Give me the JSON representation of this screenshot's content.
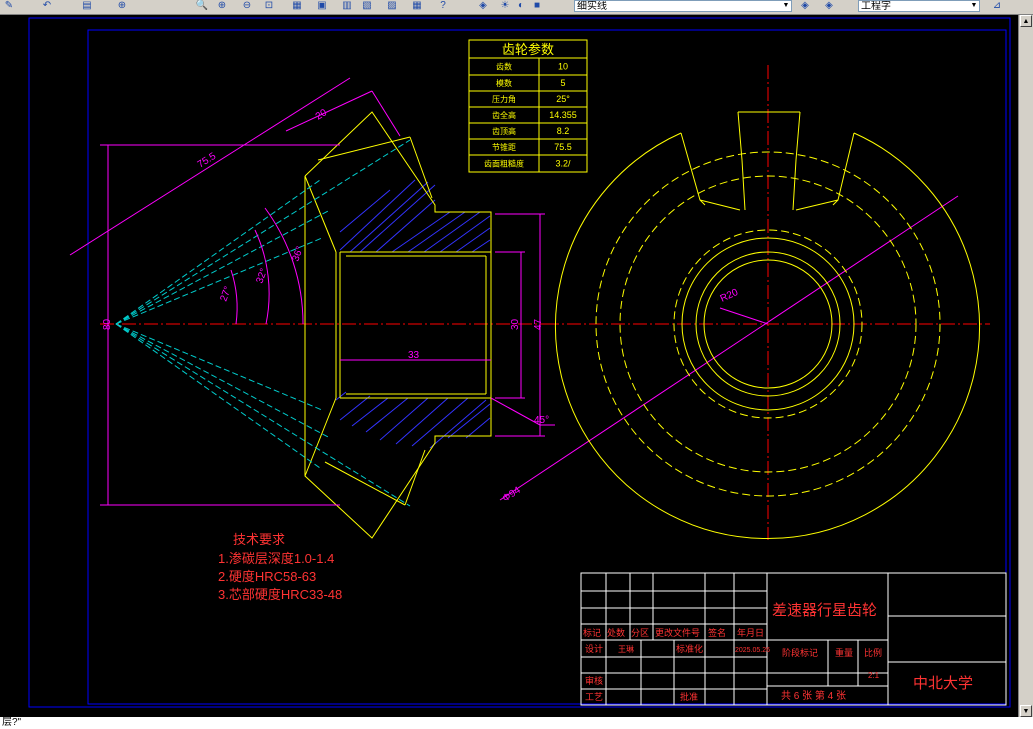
{
  "toolbar": {
    "layer_combo": "细实线",
    "workspace_combo": "工程字",
    "icons": [
      "match-properties-icon",
      "zoom-realtime-icon",
      "zoom-window-icon",
      "zoom-previous-icon",
      "properties-icon",
      "design-center-icon",
      "tool-palette-icon",
      "calculator-icon",
      "layer-manager-icon"
    ]
  },
  "gear_params": {
    "title": "齿轮参数",
    "rows": [
      {
        "label": "齿数",
        "value": "10"
      },
      {
        "label": "模数",
        "value": "5"
      },
      {
        "label": "压力角",
        "value": "25°"
      },
      {
        "label": "齿全高",
        "value": "14.355"
      },
      {
        "label": "齿顶高",
        "value": "8.2"
      },
      {
        "label": "节锥距",
        "value": "75.5"
      },
      {
        "label": "齿面粗糙度",
        "value": "3.2/"
      }
    ]
  },
  "dims": {
    "d755": "75.5",
    "d20": "20",
    "d33": "33",
    "d30": "30",
    "d47": "47",
    "d80": "80",
    "d45": "45°",
    "a27": "27°",
    "a32": "32°",
    "a36": "36°",
    "r20": "R20",
    "phi94": "Φ94"
  },
  "tech_req": {
    "title": "技术要求",
    "items": [
      "1.渗碳层深度1.0-1.4",
      "2.硬度HRC58-63",
      "3.芯部硬度HRC33-48"
    ]
  },
  "title_block": {
    "drawing_name": "差速器行星齿轮",
    "school": "中北大学",
    "row_headers": [
      "标记",
      "处数",
      "分区",
      "更改文件号",
      "签名",
      "年月日"
    ],
    "design_label": "设计",
    "designer": "王琳",
    "standardize_label": "标准化",
    "date": "2025.05.26",
    "stage_label": "阶段标记",
    "weight_label": "重量",
    "scale_label": "比例",
    "scale_value": "2:1",
    "review_label": "审核",
    "process_label": "工艺",
    "approve_label": "批准",
    "sheets": "共 6 张 第 4 张"
  },
  "command_line": "层?\"",
  "colors": {
    "background": "#000000",
    "outline": "#ffff00",
    "dimension": "#ff00ff",
    "centerline": "#ff0000",
    "hatch": "#3333ff",
    "hidden": "#00cccc",
    "frame": "#0000ff",
    "titleblock_line": "#ffffff",
    "text_red": "#ff3333"
  }
}
